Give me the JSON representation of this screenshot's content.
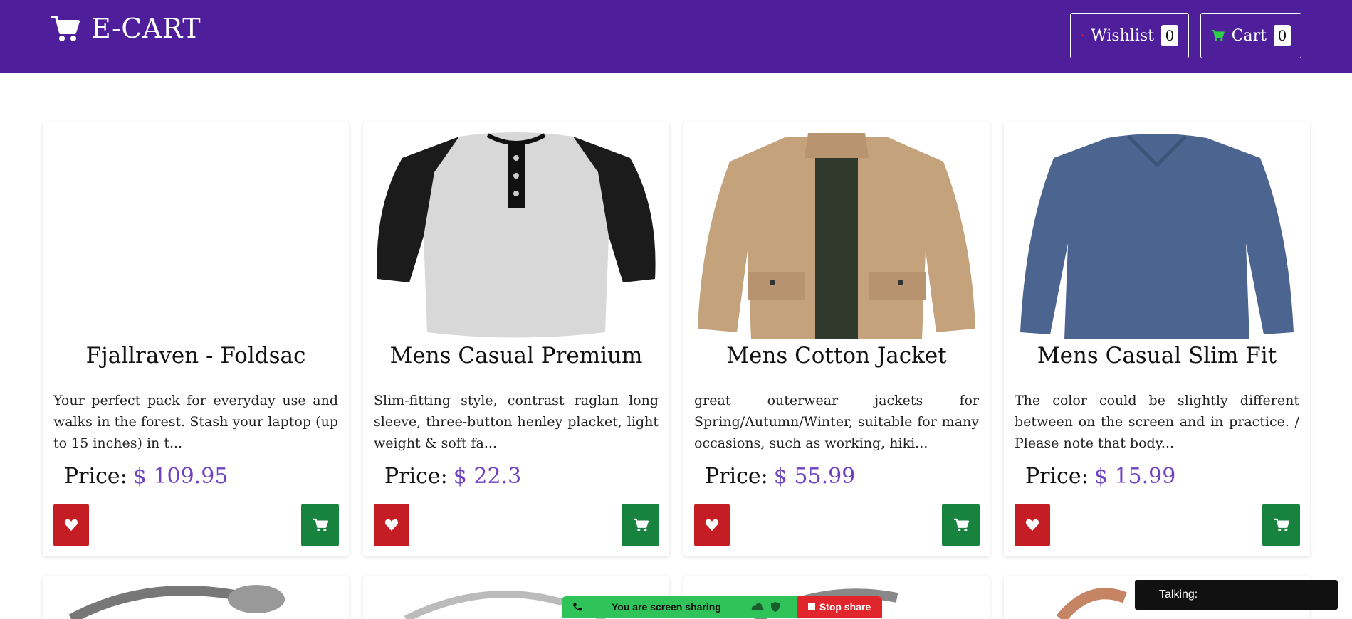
{
  "header": {
    "brand": "E-CART",
    "wishlist_label": "Wishlist",
    "wishlist_count": "0",
    "cart_label": "Cart",
    "cart_count": "0"
  },
  "products": [
    {
      "title": "Fjallraven - Foldsac",
      "description": "Your perfect pack for everyday use and walks in the forest. Stash your laptop (up to 15 inches) in t...",
      "price_label": "Price:",
      "price": "$ 109.95"
    },
    {
      "title": "Mens Casual Premium",
      "description": "Slim-fitting style, contrast raglan long sleeve, three-button henley placket, light weight & soft fa...",
      "price_label": "Price:",
      "price": "$ 22.3"
    },
    {
      "title": "Mens Cotton Jacket",
      "description": "great outerwear jackets for Spring/Autumn/Winter, suitable for many occasions, such as working, hiki...",
      "price_label": "Price:",
      "price": "$ 55.99"
    },
    {
      "title": "Mens Casual Slim Fit",
      "description": "The color could be slightly different between on the screen and in practice. / Please note that body...",
      "price_label": "Price:",
      "price": "$ 15.99"
    }
  ],
  "overlay": {
    "sharing_text": "You are screen sharing",
    "stop_share_label": "Stop share",
    "talking_label": "Talking:"
  },
  "colors": {
    "navbar": "#4f1e9b",
    "price": "#6f42c1",
    "wishlist_button": "#c41d24",
    "cart_button": "#18823f"
  }
}
